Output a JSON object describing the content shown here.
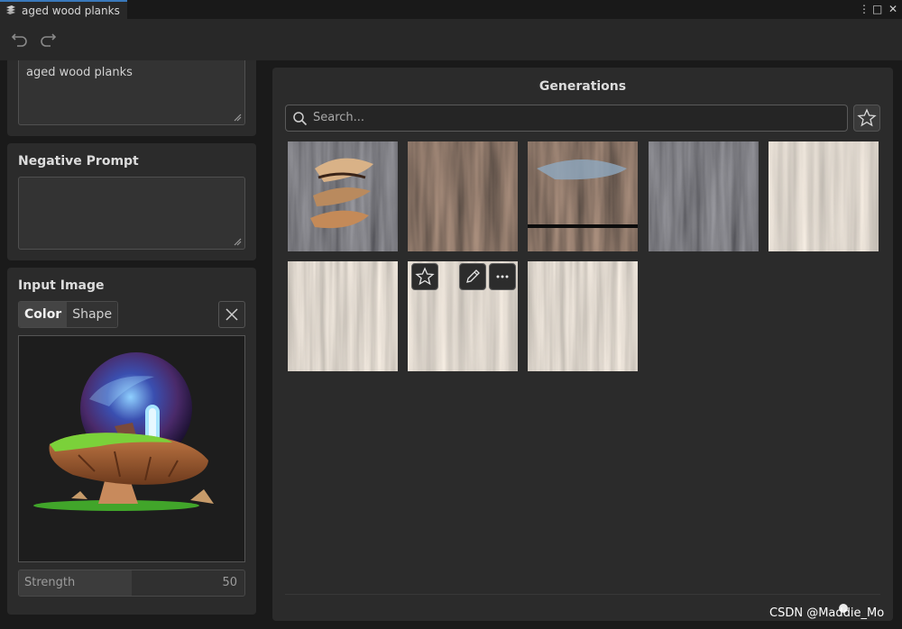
{
  "window": {
    "tab_title": "aged wood planks",
    "controls": [
      "⋮",
      "□",
      "✕"
    ]
  },
  "toolbar": {
    "buttons": [
      "undo-icon",
      "redo-icon"
    ]
  },
  "prompt": {
    "value": "aged wood planks"
  },
  "negative_prompt": {
    "title": "Negative Prompt",
    "value": ""
  },
  "input_image": {
    "title": "Input Image",
    "modes": [
      "Color",
      "Shape"
    ],
    "selected_mode": "Color",
    "strength_label": "Strength",
    "strength_value": "50"
  },
  "generations": {
    "title": "Generations",
    "search_placeholder": "Search...",
    "thumbnail_count": 8,
    "hover_actions": [
      "star-icon",
      "pencil-icon",
      "more-icon"
    ]
  },
  "watermark": "CSDN @Maddie_Mo",
  "colors": {
    "background": "#1a1a1a",
    "panel": "#2b2b2b",
    "accent": "#3a79bb"
  }
}
